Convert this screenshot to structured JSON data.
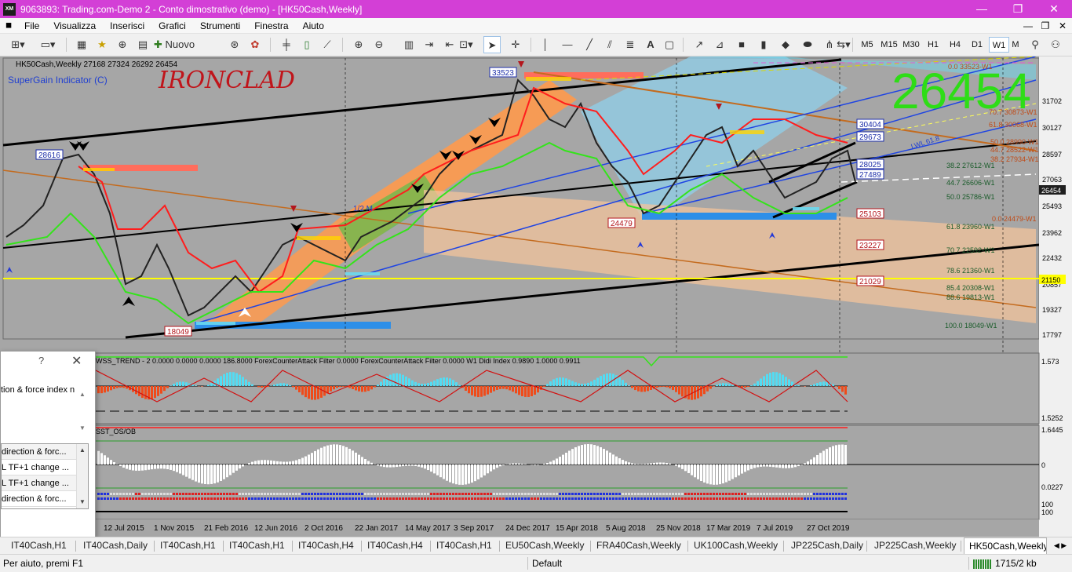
{
  "window": {
    "title": "9063893: Trading.com-Demo 2 - Conto dimostrativo (demo) - [HK50Cash,Weekly]",
    "app_badge": "XM",
    "minimize": "—",
    "maximize": "❐",
    "close": "✕"
  },
  "menu": {
    "items": [
      "File",
      "Visualizza",
      "Inserisci",
      "Grafici",
      "Strumenti",
      "Finestra",
      "Aiuto"
    ],
    "mdi_minimize": "—",
    "mdi_restore": "❐",
    "mdi_close": "✕"
  },
  "toolbar": {
    "new_order_label": "Nuovo ordine",
    "timeframes": [
      "M5",
      "M15",
      "M30",
      "H1",
      "H4",
      "D1",
      "W1",
      "M"
    ],
    "active_timeframe": "W1"
  },
  "chart": {
    "info": "HK50Cash,Weekly  27168 27324 26292 26454",
    "indicator_name": "SuperGain Indicator (C)",
    "watermark": "IRONCLAD",
    "big_price": "26454",
    "price_labels": [
      {
        "text": "33523",
        "color": "#1c2ea8"
      },
      {
        "text": "28616",
        "color": "#1c2ea8"
      },
      {
        "text": "24479",
        "color": "#b3161c"
      },
      {
        "text": "18049",
        "color": "#b3161c"
      },
      {
        "text": "30404",
        "color": "#1c2ea8"
      },
      {
        "text": "29673",
        "color": "#1c2ea8"
      },
      {
        "text": "28025",
        "color": "#1c2ea8"
      },
      {
        "text": "27489",
        "color": "#1c2ea8"
      },
      {
        "text": "25103",
        "color": "#b3161c"
      },
      {
        "text": "23227",
        "color": "#b3161c"
      },
      {
        "text": "21029",
        "color": "#b3161c"
      }
    ],
    "fib_levels": [
      {
        "text": "0.0 33523-W1"
      },
      {
        "text": "70.7 30873-W1"
      },
      {
        "text": "61.8 30068-W1"
      },
      {
        "text": "50.0 28990-W1"
      },
      {
        "text": "44.7 28522-W1"
      },
      {
        "text": "38.2 27934-W1"
      },
      {
        "text": "38.2 27612-W1"
      },
      {
        "text": "44.7 26606-W1"
      },
      {
        "text": "50.0 25786-W1"
      },
      {
        "text": "0.0 24479-W1"
      },
      {
        "text": "61.8 23960-W1"
      },
      {
        "text": "70.7 22592-W1"
      },
      {
        "text": "78.6 21360-W1"
      },
      {
        "text": "85.4 20308-W1"
      },
      {
        "text": "88.6 19813-W1"
      },
      {
        "text": "100.0 18049-W1"
      }
    ],
    "annotations": {
      "half_label": "1/2 M",
      "channel_label": "LWL 61.8"
    },
    "y_axis": [
      "31702",
      "30127",
      "28597",
      "27063",
      "25493",
      "23962",
      "22432",
      "20857",
      "19327",
      "17797"
    ],
    "y_axis_current": "26454",
    "y_axis_line": "21150",
    "x_axis": [
      "12 Jul 2015",
      "1 Nov 2015",
      "21 Feb 2016",
      "12 Jun 2016",
      "2 Oct 2016",
      "22 Jan 2017",
      "14 May 2017",
      "3 Sep 2017",
      "24 Dec 2017",
      "15 Apr 2018",
      "5 Aug 2018",
      "25 Nov 2018",
      "17 Mar 2019",
      "7 Jul 2019",
      "27 Oct 2019"
    ],
    "subwindow1": {
      "label": "WSS_TREND - 2 0.0000 0.0000 0.0000 186.8000  ForexCounterAttack Filter 0.0000  ForexCounterAttack Filter 0.0000  W1 Didi Index 0.9890 1.0000 0.9911",
      "y_top": "1.573",
      "y_bottom": "1.5252"
    },
    "subwindow2": {
      "label": "SST_OS/OB",
      "y_top": "1.6445",
      "y_zero": "0",
      "y_bottom": "0.0227",
      "y_100a": "100",
      "y_100b": "100"
    }
  },
  "dialog": {
    "help": "?",
    "close": "✕",
    "description": "tion & force index n",
    "list": [
      "direction & forc...",
      "L TF+1 change ...",
      "L TF+1 change ...",
      "direction & forc..."
    ]
  },
  "tabs": {
    "items": [
      "IT40Cash,H1",
      "IT40Cash,Daily",
      "IT40Cash,H1",
      "IT40Cash,H1",
      "IT40Cash,H4",
      "IT40Cash,H4",
      "IT40Cash,H1",
      "EU50Cash,Weekly",
      "FRA40Cash,Weekly",
      "UK100Cash,Weekly",
      "JP225Cash,Daily",
      "JP225Cash,Weekly",
      "HK50Cash,Weekly"
    ],
    "active": "HK50Cash,Weekly"
  },
  "status": {
    "help": "Per aiuto, premi F1",
    "profile": "Default",
    "traffic": "1715/2 kb"
  }
}
